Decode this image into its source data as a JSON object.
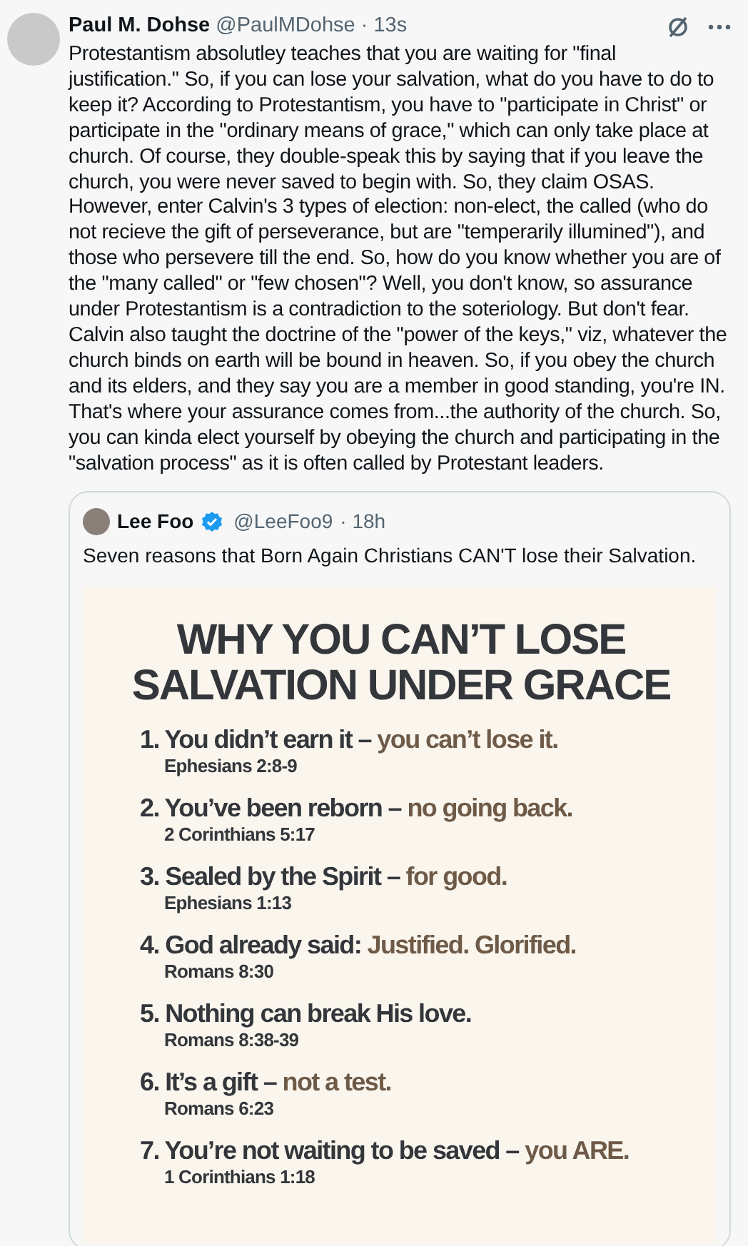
{
  "post": {
    "author": "Paul M. Dohse",
    "handle": "@PaulMDohse",
    "time": "· 13s",
    "text": "Protestantism absolutley teaches that you are waiting for \"final justification.\" So, if you can lose your salvation, what do you have to do to keep it? According to Protestantism, you have to \"participate in Christ\" or participate in the \"ordinary means of grace,\" which can only take place at church. Of course, they double-speak this by saying that if you leave the church, you were never saved to begin with. So, they claim OSAS. However, enter Calvin's 3 types of election: non-elect, the called (who do not recieve the gift of perseverance, but are \"temperarily illumined\"), and those who persevere till the end. So, how do you know whether you are of the \"many called\" or \"few chosen\"? Well, you don't know, so assurance under Protestantism is a contradiction to the soteriology. But don't fear. Calvin also taught the doctrine of the \"power of the keys,\" viz, whatever the church binds on earth will be bound in heaven. So, if you obey the church and its elders, and they say you are a member in good standing, you're IN. That's where your assurance comes from...the authority of the church. So, you can kinda elect yourself by obeying the church and participating in the \"salvation process\" as it is often called by Protestant leaders."
  },
  "quote": {
    "author": "Lee Foo",
    "verified": true,
    "handle": "@LeeFoo9",
    "time": "· 18h",
    "text": "Seven reasons that Born Again Christians CAN'T lose their Salvation.",
    "image": {
      "title": [
        "WHY YOU CAN’T LOSE",
        "SALVATION UNDER GRACE"
      ],
      "items": [
        {
          "main": "1. You didn’t earn it – ",
          "accent": "you can’t lose it.",
          "ref": "Ephesians 2:8-9"
        },
        {
          "main": "2. You’ve been reborn – ",
          "accent": "no going back.",
          "ref": "2 Corinthians 5:17"
        },
        {
          "main": "3. Sealed by the Spirit – ",
          "accent": "for good.",
          "ref": "Ephesians 1:13"
        },
        {
          "main": "4. God already said: ",
          "accent": "Justified. Glorified.",
          "ref": "Romans 8:30"
        },
        {
          "main": "5. Nothing can break His love.",
          "ref": "Romans 8:38-39"
        },
        {
          "main": "6. It’s a gift – ",
          "accent": "not a test.",
          "ref": "Romans 6:23"
        },
        {
          "main": "7. You’re not waiting to be saved – ",
          "accent": "you ARE.",
          "ref": "1 Corinthians 1:18"
        }
      ]
    }
  }
}
